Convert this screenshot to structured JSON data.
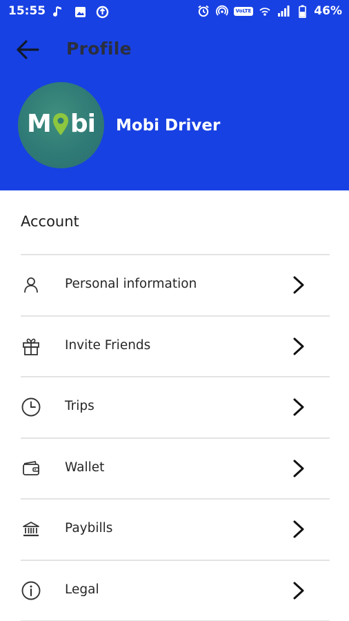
{
  "status_bar": {
    "time": "15:55",
    "left_icons": [
      "music-note-icon",
      "image-icon",
      "data-saver-icon"
    ],
    "right_icons": [
      "alarm-icon",
      "hotspot-icon",
      "volte-icon",
      "wifi-signal-icon",
      "cell-signal-icon",
      "battery-icon"
    ],
    "volte_label": "VoLTE",
    "battery": "46%"
  },
  "header": {
    "title": "Profile",
    "back_icon": "arrow-left-icon",
    "background_color": "#1841e3",
    "avatar_logo": "Mobi",
    "logo_pin_color": "#8dc63f",
    "driver_name": "Mobi Driver"
  },
  "section": {
    "title": "Account"
  },
  "menu": {
    "items": [
      {
        "label": "Personal information",
        "icon": "person-icon"
      },
      {
        "label": "Invite Friends",
        "icon": "gift-icon"
      },
      {
        "label": "Trips",
        "icon": "clock-icon"
      },
      {
        "label": "Wallet",
        "icon": "wallet-icon"
      },
      {
        "label": "Paybills",
        "icon": "bank-icon"
      },
      {
        "label": "Legal",
        "icon": "info-icon"
      }
    ],
    "chevron_icon": "chevron-right-icon"
  }
}
